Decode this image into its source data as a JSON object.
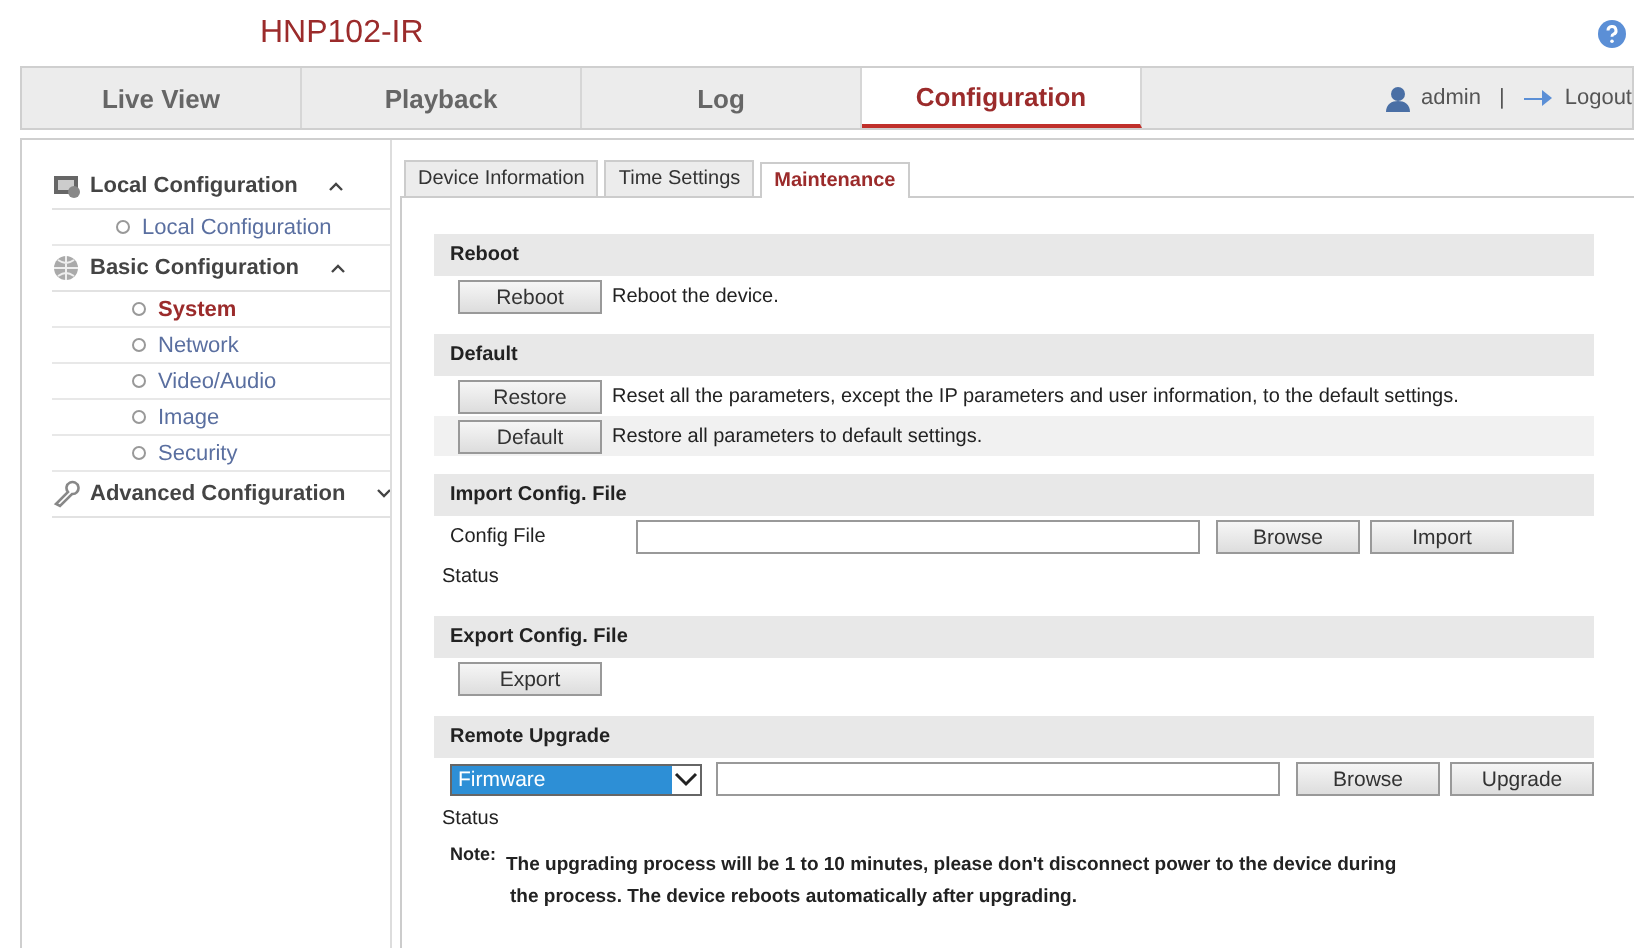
{
  "header": {
    "title": "HNP102-IR"
  },
  "nav": {
    "tabs": [
      {
        "label": "Live View",
        "selected": false
      },
      {
        "label": "Playback",
        "selected": false
      },
      {
        "label": "Log",
        "selected": false
      },
      {
        "label": "Configuration",
        "selected": true
      }
    ],
    "user": "admin",
    "separator": "|",
    "logout": "Logout"
  },
  "sidebar": {
    "groups": [
      {
        "label": "Local Configuration",
        "expanded": true,
        "items": [
          {
            "label": "Local Configuration",
            "selected": false
          }
        ]
      },
      {
        "label": "Basic Configuration",
        "expanded": true,
        "items": [
          {
            "label": "System",
            "selected": true
          },
          {
            "label": "Network",
            "selected": false
          },
          {
            "label": "Video/Audio",
            "selected": false
          },
          {
            "label": "Image",
            "selected": false
          },
          {
            "label": "Security",
            "selected": false
          }
        ]
      },
      {
        "label": "Advanced Configuration",
        "expanded": false
      }
    ]
  },
  "tabs": [
    {
      "label": "Device Information",
      "selected": false
    },
    {
      "label": "Time Settings",
      "selected": false
    },
    {
      "label": "Maintenance",
      "selected": true
    }
  ],
  "sections": [
    {
      "title": "Reboot",
      "rows": [
        {
          "kind": "action",
          "button": "Reboot",
          "text": "Reboot the device."
        }
      ]
    },
    {
      "title": "Default",
      "rows": [
        {
          "kind": "action",
          "button": "Restore",
          "text": "Reset all the parameters, except the IP parameters and user information, to the default settings."
        },
        {
          "kind": "action",
          "button": "Default",
          "text": "Restore all parameters to default settings."
        }
      ]
    },
    {
      "title": "Import Config. File",
      "rows": [
        {
          "kind": "file",
          "label": "Config File",
          "buttons": [
            "Browse",
            "Import"
          ]
        },
        {
          "kind": "status",
          "label": "Status"
        }
      ]
    },
    {
      "title": "Export Config. File",
      "rows": [
        {
          "kind": "button",
          "button": "Export"
        }
      ]
    },
    {
      "title": "Remote Upgrade",
      "rows": [
        {
          "kind": "select_file",
          "value": "Firmware",
          "buttons": [
            "Browse",
            "Upgrade"
          ]
        },
        {
          "kind": "status",
          "label": "Status"
        },
        {
          "kind": "note",
          "label": "Note:",
          "lines": [
            "The upgrading process will be 1 to 10 minutes, please don't disconnect power to the device during",
            "the process. The device reboots automatically after upgrading."
          ]
        }
      ]
    }
  ]
}
